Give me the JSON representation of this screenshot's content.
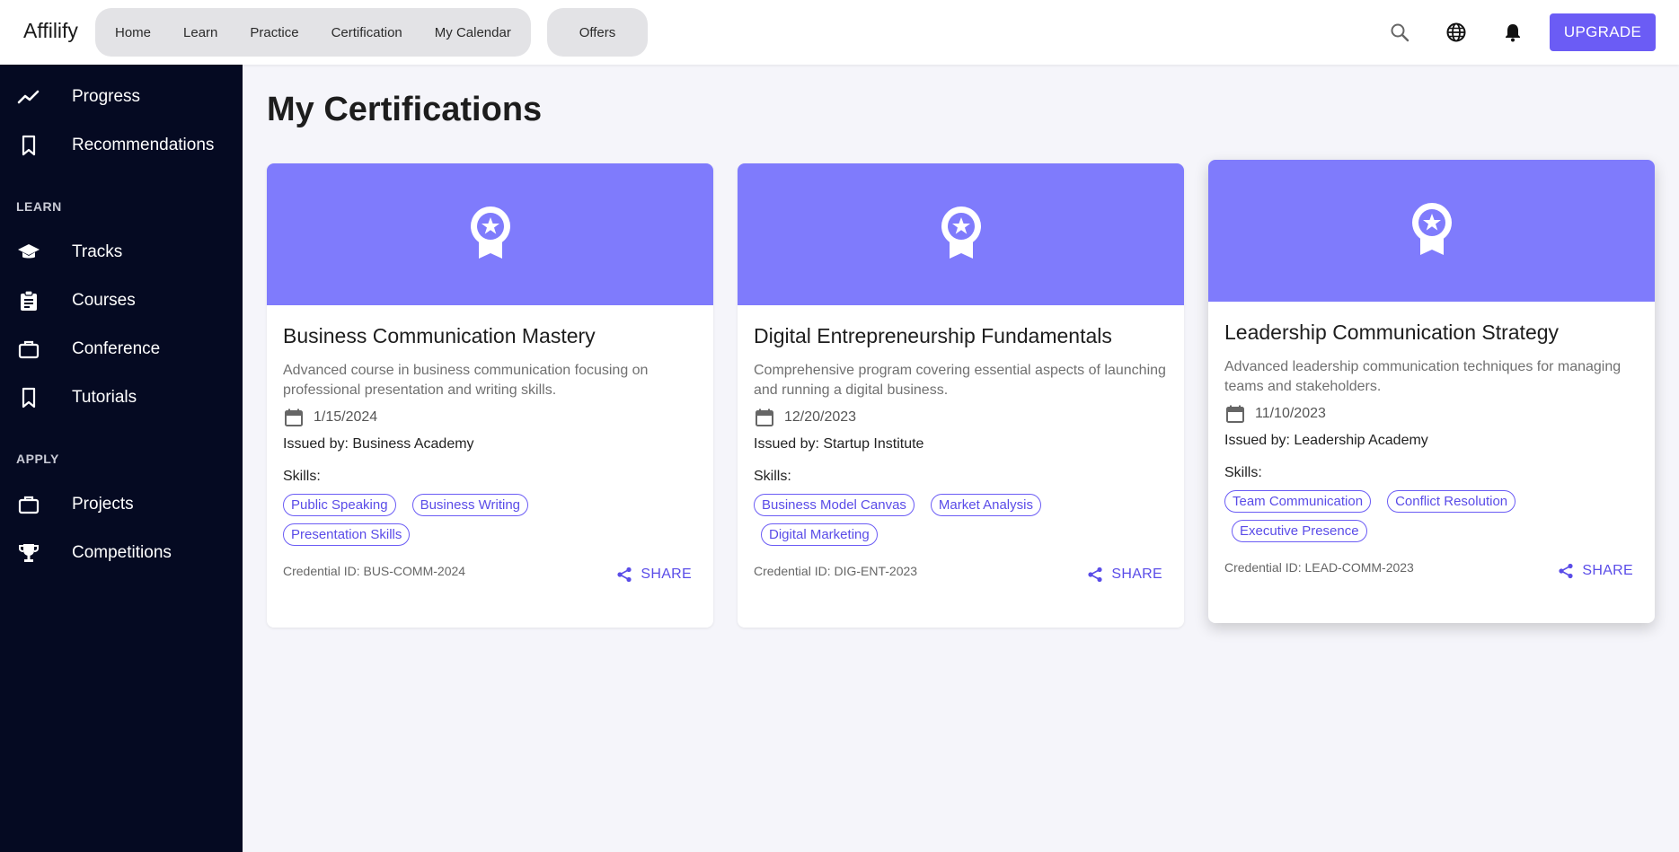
{
  "header": {
    "brand": "Affilify",
    "nav": [
      "Home",
      "Learn",
      "Practice",
      "Certification",
      "My Calendar"
    ],
    "offers": "Offers",
    "icons": [
      "search-icon",
      "globe-icon",
      "bell-icon"
    ],
    "upgrade_label": "UPGRADE"
  },
  "sidebar": {
    "top_items": [
      {
        "label": "Progress",
        "icon": "trending-up-icon"
      },
      {
        "label": "Recommendations",
        "icon": "bookmark-icon"
      }
    ],
    "learn_title": "LEARN",
    "learn_items": [
      {
        "label": "Tracks",
        "icon": "graduation-cap-icon"
      },
      {
        "label": "Courses",
        "icon": "clipboard-icon"
      },
      {
        "label": "Conference",
        "icon": "briefcase-icon"
      },
      {
        "label": "Tutorials",
        "icon": "bookmark-icon"
      }
    ],
    "apply_title": "APPLY",
    "apply_items": [
      {
        "label": "Projects",
        "icon": "briefcase-icon"
      },
      {
        "label": "Competitions",
        "icon": "trophy-icon"
      }
    ]
  },
  "main": {
    "title": "My Certifications",
    "skills_label": "Skills:",
    "share_label": "SHARE",
    "cards": [
      {
        "title": "Business Communication Mastery",
        "description": "Advanced course in business communication focusing on professional presentation and writing skills.",
        "date": "1/15/2024",
        "issued_by": "Issued by: Business Academy",
        "skills": [
          "Public Speaking",
          "Business Writing",
          "Presentation Skills"
        ],
        "credential": "Credential ID: BUS-COMM-2024"
      },
      {
        "title": "Digital Entrepreneurship Fundamentals",
        "description": "Comprehensive program covering essential aspects of launching and running a digital business.",
        "date": "12/20/2023",
        "issued_by": "Issued by: Startup Institute",
        "skills": [
          "Business Model Canvas",
          "Market Analysis",
          "Digital Marketing"
        ],
        "credential": "Credential ID: DIG-ENT-2023"
      },
      {
        "title": "Leadership Communication Strategy",
        "description": "Advanced leadership communication techniques for managing teams and stakeholders.",
        "date": "11/10/2023",
        "issued_by": "Issued by: Leadership Academy",
        "skills": [
          "Team Communication",
          "Conflict Resolution",
          "Executive Presence"
        ],
        "credential": "Credential ID: LEAD-COMM-2023"
      }
    ]
  },
  "colors": {
    "accent": "#6b5cf5",
    "banner": "#7f7bfc",
    "sidebar_bg": "#050a22"
  }
}
